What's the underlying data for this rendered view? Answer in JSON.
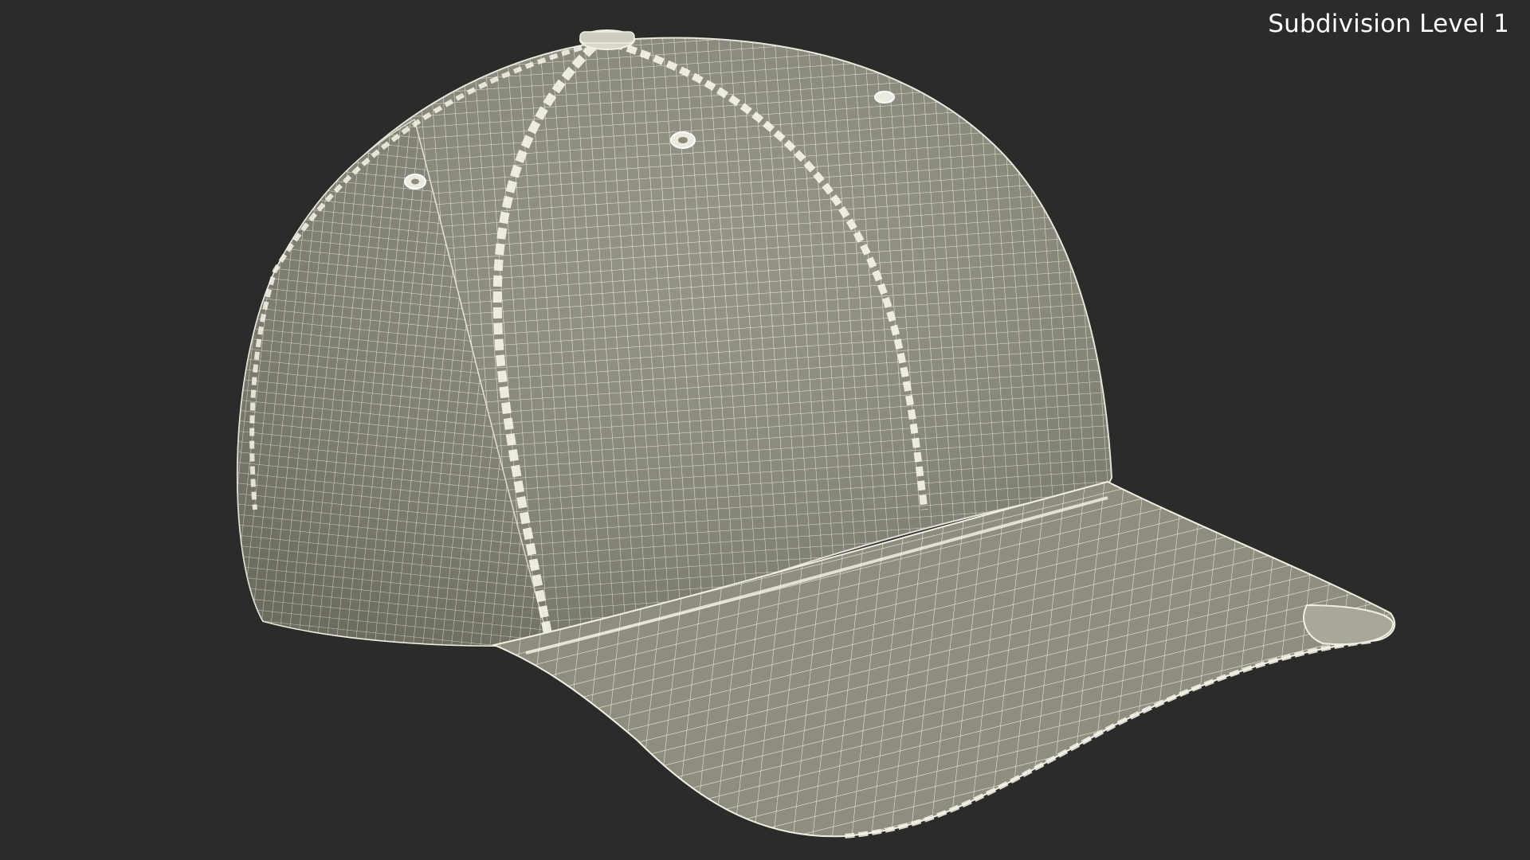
{
  "viewport": {
    "label": "Subdivision Level 1",
    "background": "#2b2b2a",
    "mesh_fill": "#8b8a7c",
    "wire_color": "#f1efe2"
  }
}
